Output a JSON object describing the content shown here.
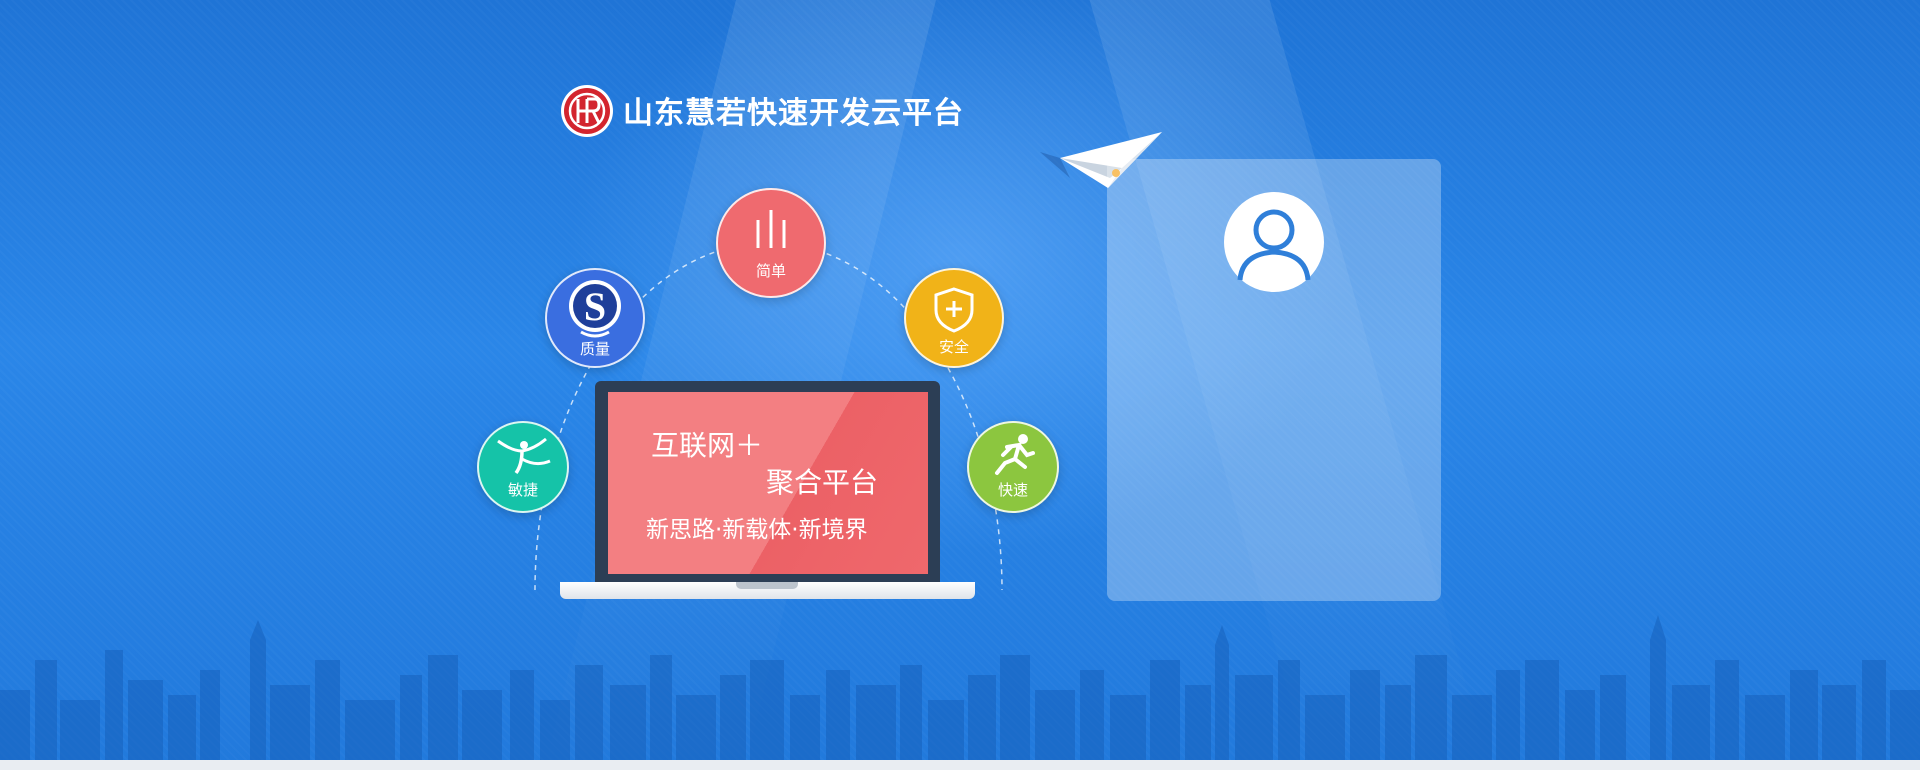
{
  "header": {
    "title": "山东慧若快速开发云平台"
  },
  "features": {
    "simple": "简单",
    "quality": "质量",
    "safe": "安全",
    "agile": "敏捷",
    "fast": "快速"
  },
  "screen": {
    "line1": "互联网＋",
    "line2": "聚合平台",
    "line3": "新思路·新载体·新境界"
  },
  "colors": {
    "background": "#2a86e8",
    "simple": "#ef6a6f",
    "quality": "#3a6ee0",
    "safe": "#f1b318",
    "agile": "#15c3a8",
    "fast": "#8cc63f",
    "screen": "#f37f82"
  },
  "icons": {
    "logo": "hr-logo-icon",
    "simple": "bars-icon",
    "quality": "s-logo-icon",
    "safe": "shield-plus-icon",
    "agile": "gymnast-icon",
    "fast": "runner-icon",
    "avatar": "user-icon",
    "plane": "paper-plane-icon"
  }
}
